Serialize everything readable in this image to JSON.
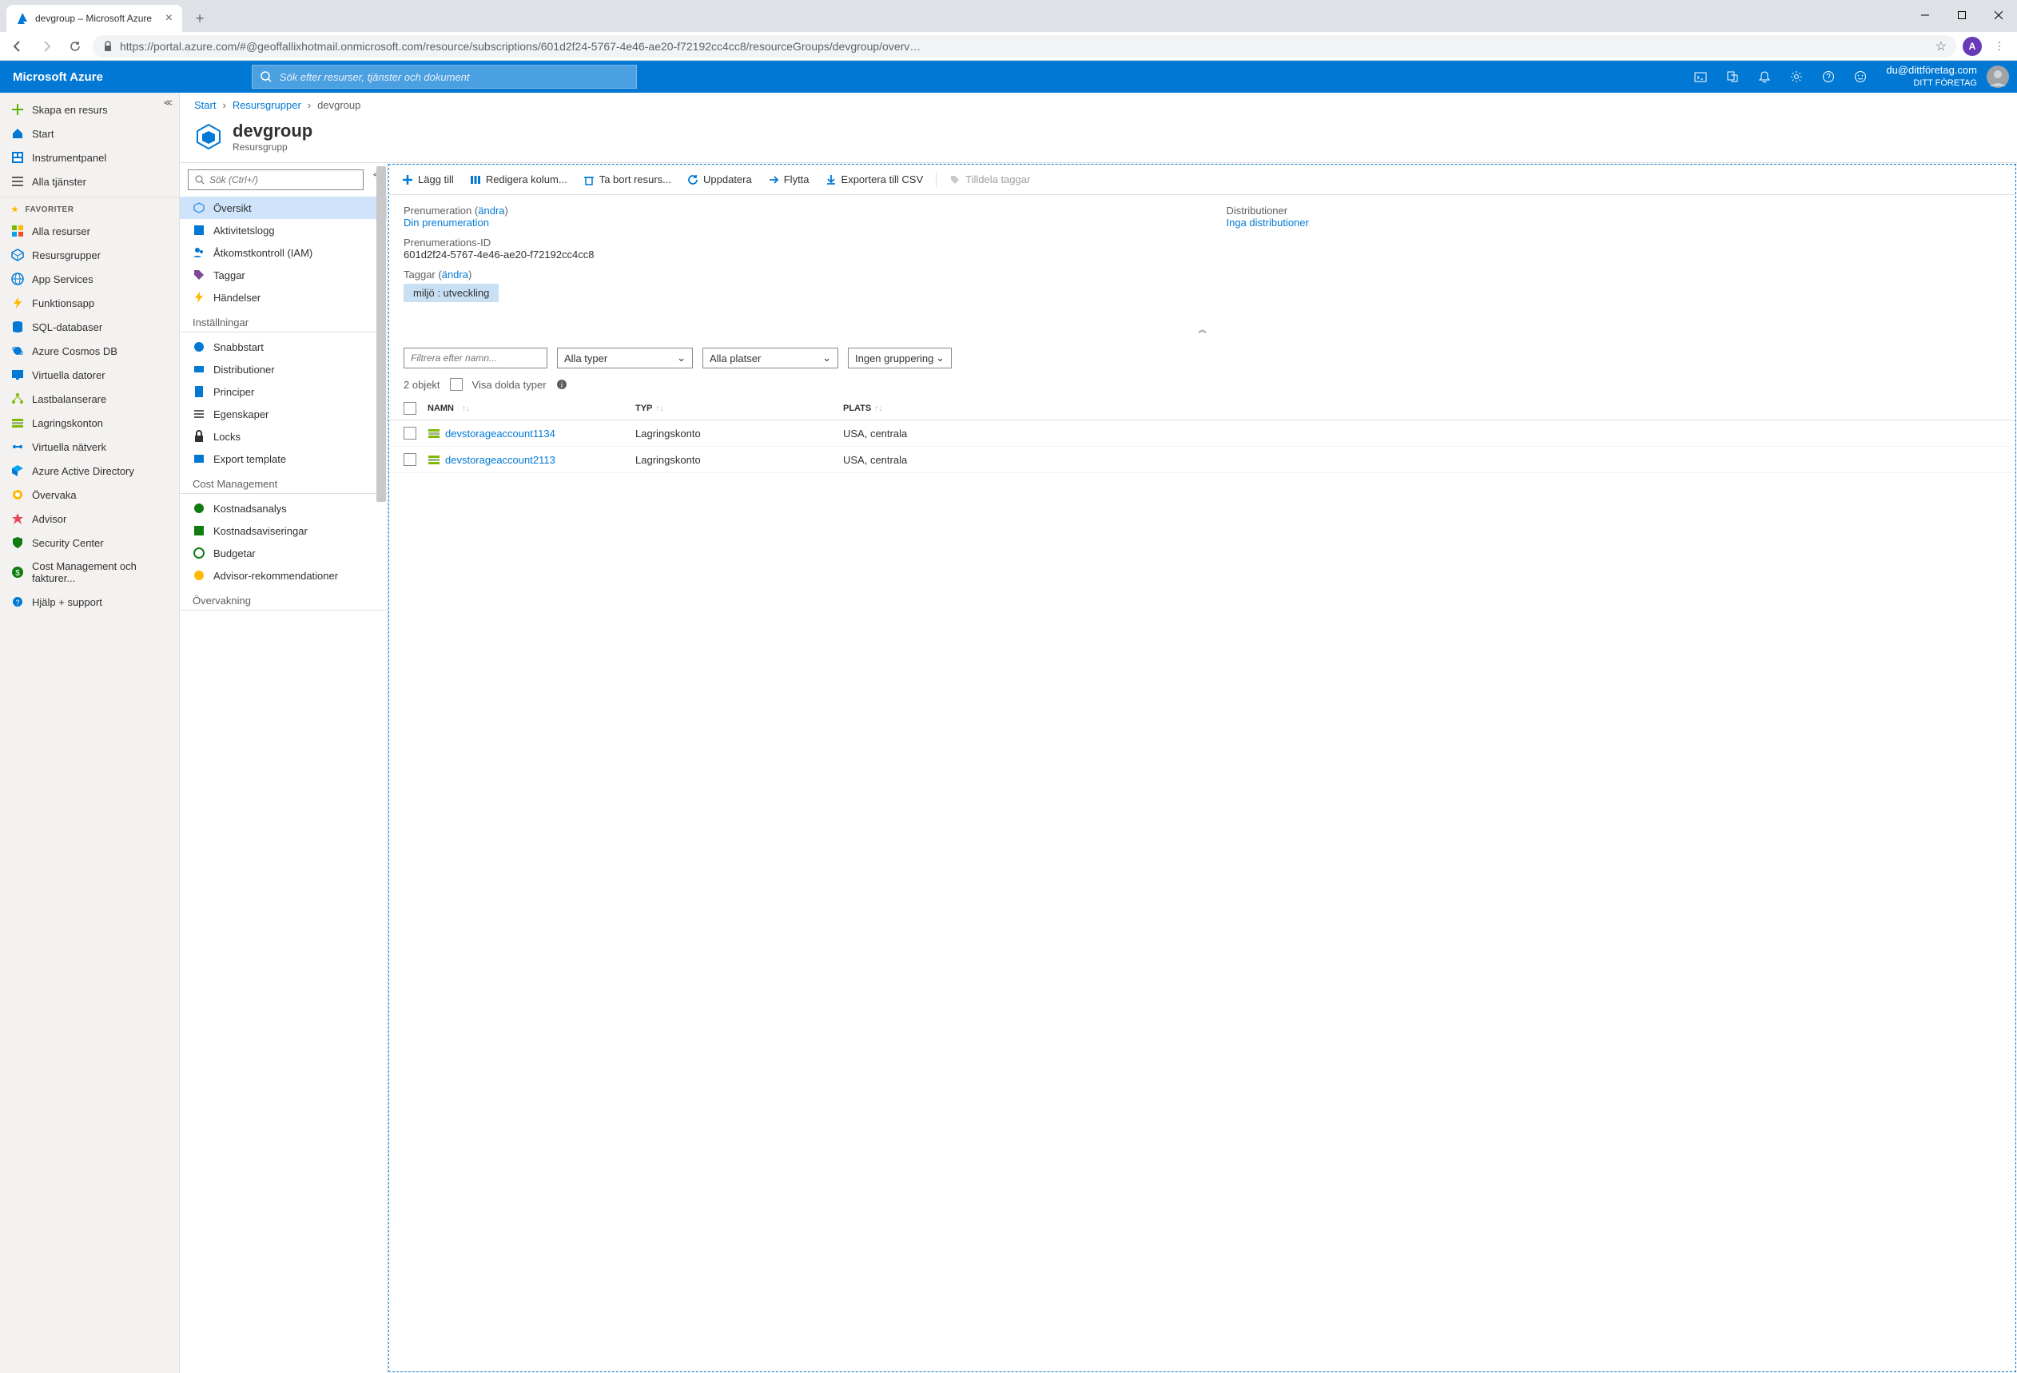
{
  "browser": {
    "tab_title": "devgroup – Microsoft Azure",
    "url": "https://portal.azure.com/#@geoffallixhotmail.onmicrosoft.com/resource/subscriptions/601d2f24-5767-4e46-ae20-f72192cc4cc8/resourceGroups/devgroup/overv…",
    "avatar_letter": "A"
  },
  "header": {
    "brand": "Microsoft Azure",
    "search_placeholder": "Sök efter resurser, tjänster och dokument",
    "user_email": "du@dittföretag.com",
    "user_org": "DITT FÖRETAG"
  },
  "sidebar": {
    "create": "Skapa en resurs",
    "home": "Start",
    "dashboard": "Instrumentpanel",
    "all_services": "Alla tjänster",
    "favorites_label": "FAVORITER",
    "items": [
      "Alla resurser",
      "Resursgrupper",
      "App Services",
      "Funktionsapp",
      "SQL-databaser",
      "Azure Cosmos DB",
      "Virtuella datorer",
      "Lastbalanserare",
      "Lagringskonton",
      "Virtuella nätverk",
      "Azure Active Directory",
      "Övervaka",
      "Advisor",
      "Security Center",
      "Cost Management och fakturer...",
      "Hjälp + support"
    ]
  },
  "breadcrumb": {
    "root": "Start",
    "mid": "Resursgrupper",
    "leaf": "devgroup"
  },
  "page": {
    "title": "devgroup",
    "subtitle": "Resursgrupp"
  },
  "submenu": {
    "search_placeholder": "Sök (Ctrl+/)",
    "main": [
      "Översikt",
      "Aktivitetslogg",
      "Åtkomstkontroll (IAM)",
      "Taggar",
      "Händelser"
    ],
    "settings_label": "Inställningar",
    "settings": [
      "Snabbstart",
      "Distributioner",
      "Principer",
      "Egenskaper",
      "Locks",
      "Export template"
    ],
    "cost_label": "Cost Management",
    "cost": [
      "Kostnadsanalys",
      "Kostnadsaviseringar",
      "Budgetar",
      "Advisor-rekommendationer"
    ],
    "monitor_label": "Övervakning"
  },
  "toolbar": {
    "add": "Lägg till",
    "editcols": "Redigera kolum...",
    "delete": "Ta bort resurs...",
    "refresh": "Uppdatera",
    "move": "Flytta",
    "export": "Exportera till CSV",
    "tags": "Tilldela taggar"
  },
  "essentials": {
    "sub_label": "Prenumeration",
    "change": "ändra",
    "sub_link": "Din prenumeration",
    "subid_label": "Prenumerations-ID",
    "subid": "601d2f24-5767-4e46-ae20-f72192cc4cc8",
    "tags_label": "Taggar",
    "tag_value": "miljö : utveckling",
    "deploy_label": "Distributioner",
    "deploy_link": "Inga distributioner"
  },
  "filters": {
    "name_placeholder": "Filtrera efter namn...",
    "types": "Alla typer",
    "locations": "Alla platser",
    "grouping": "Ingen gruppering"
  },
  "grid": {
    "count": "2 objekt",
    "show_hidden": "Visa dolda typer",
    "cols": {
      "name": "NAMN",
      "type": "TYP",
      "location": "PLATS"
    },
    "rows": [
      {
        "name": "devstorageaccount1134",
        "type": "Lagringskonto",
        "location": "USA, centrala"
      },
      {
        "name": "devstorageaccount2113",
        "type": "Lagringskonto",
        "location": "USA, centrala"
      }
    ]
  }
}
